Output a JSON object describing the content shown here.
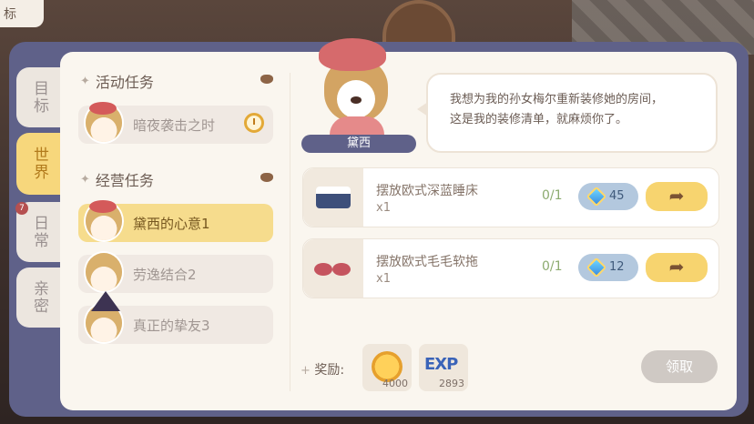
{
  "corner_label": "标",
  "side_tabs": [
    {
      "label": "目标",
      "active": false
    },
    {
      "label": "世界",
      "active": true
    },
    {
      "label": "日常",
      "active": false,
      "badge": "7"
    },
    {
      "label": "亲密",
      "active": false
    }
  ],
  "sections": {
    "event": {
      "title": "活动任务"
    },
    "business": {
      "title": "经营任务"
    }
  },
  "event_quests": [
    {
      "label": "暗夜袭击之时",
      "timed": true
    }
  ],
  "business_quests": [
    {
      "label": "黛西的心意1",
      "active": true
    },
    {
      "label": "劳逸结合2",
      "active": false
    },
    {
      "label": "真正的挚友3",
      "active": false
    }
  ],
  "npc": {
    "name": "黛西",
    "dialog_line1": "我想为我的孙女梅尔重新装修她的房间，",
    "dialog_line2": "这是我的装修清单，就麻烦你了。"
  },
  "tasks": [
    {
      "name": "摆放欧式深蓝睡床",
      "qty": "x1",
      "progress": "0/1",
      "cost": "45",
      "go_icon": "arrow-right-icon"
    },
    {
      "name": "摆放欧式毛毛软拖",
      "qty": "x1",
      "progress": "0/1",
      "cost": "12",
      "go_icon": "arrow-right-icon"
    }
  ],
  "reward": {
    "label": "奖励:",
    "items": [
      {
        "icon": "coin-icon",
        "amount": "4000"
      },
      {
        "icon": "exp-icon",
        "text": "EXP",
        "amount": "2893"
      }
    ]
  },
  "claim_label": "领取",
  "colors": {
    "frame": "#5f6189",
    "active_tab": "#f7d77c",
    "panel": "#faf6ef",
    "go_button": "#f7d46f",
    "cost_pill": "#b3c8de"
  }
}
